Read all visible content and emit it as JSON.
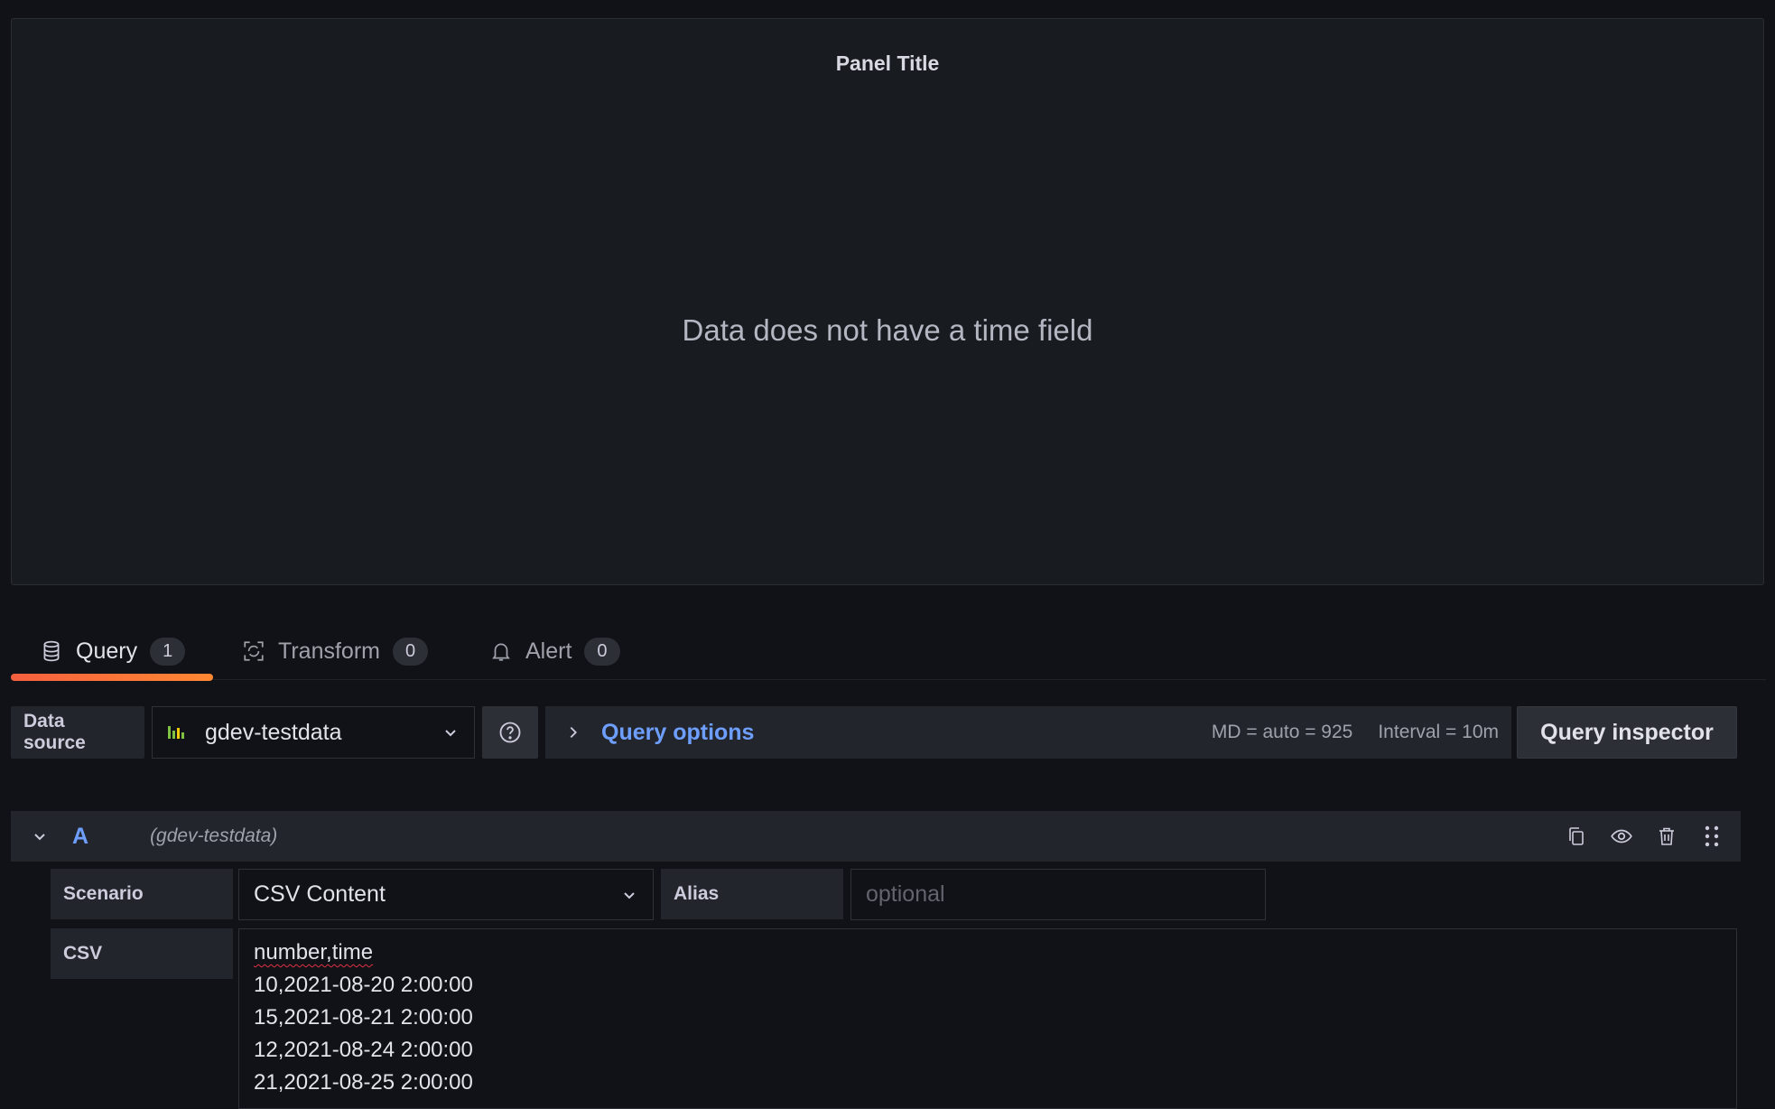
{
  "panel": {
    "title": "Panel Title",
    "message": "Data does not have a time field"
  },
  "tabs": [
    {
      "label": "Query",
      "count": "1",
      "icon": "database-icon",
      "active": true
    },
    {
      "label": "Transform",
      "count": "0",
      "icon": "transform-icon",
      "active": false
    },
    {
      "label": "Alert",
      "count": "0",
      "icon": "bell-icon",
      "active": false
    }
  ],
  "toolbar": {
    "datasource_label": "Data source",
    "datasource_value": "gdev-testdata",
    "query_options_label": "Query options",
    "md_info": "MD = auto = 925",
    "interval_info": "Interval = 10m",
    "query_inspector_label": "Query inspector"
  },
  "query": {
    "ref_id": "A",
    "datasource": "(gdev-testdata)",
    "scenario_label": "Scenario",
    "scenario_value": "CSV Content",
    "alias_label": "Alias",
    "alias_placeholder": "optional",
    "csv_label": "CSV",
    "csv_lines": [
      "number,time",
      "10,2021-08-20 2:00:00",
      "15,2021-08-21 2:00:00",
      "12,2021-08-24 2:00:00",
      "21,2021-08-25 2:00:00"
    ]
  },
  "colors": {
    "accent_link": "#6e9fff",
    "tab_underline": "#ff8833",
    "background": "#111217",
    "panel_bg": "#181b1f"
  }
}
